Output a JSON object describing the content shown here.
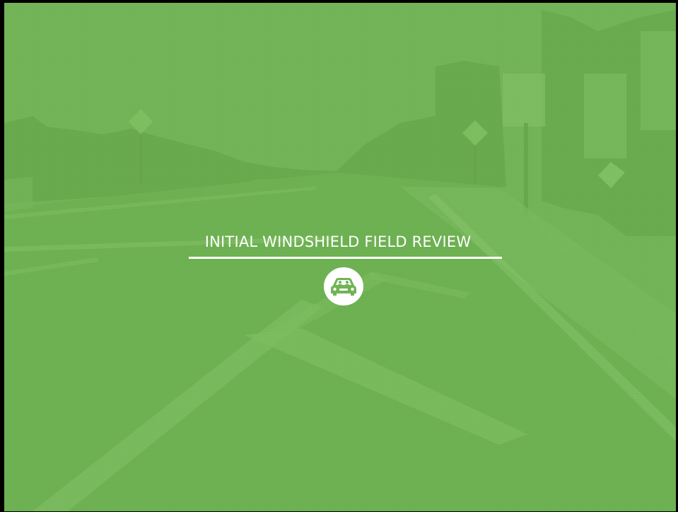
{
  "slide": {
    "title": "INITIAL WINDSHIELD FIELD REVIEW",
    "icon": "car-icon",
    "colors": {
      "background": "#71b356",
      "text": "#ffffff",
      "frame": "#000000"
    }
  }
}
